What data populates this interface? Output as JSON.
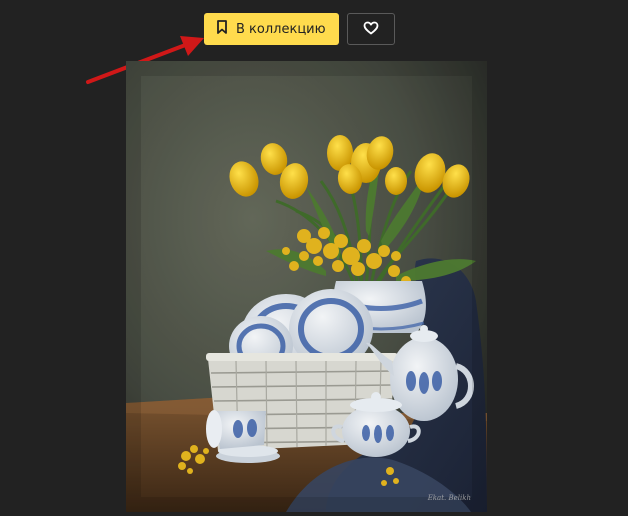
{
  "toolbar": {
    "collection_label": "В коллекцию",
    "collection_icon": "bookmark-icon",
    "like_icon": "heart-icon"
  },
  "colors": {
    "page_bg": "#222222",
    "accent": "#ffdb4d",
    "arrow": "#d01818"
  },
  "photo": {
    "signature": "Ekat. Belikh"
  }
}
